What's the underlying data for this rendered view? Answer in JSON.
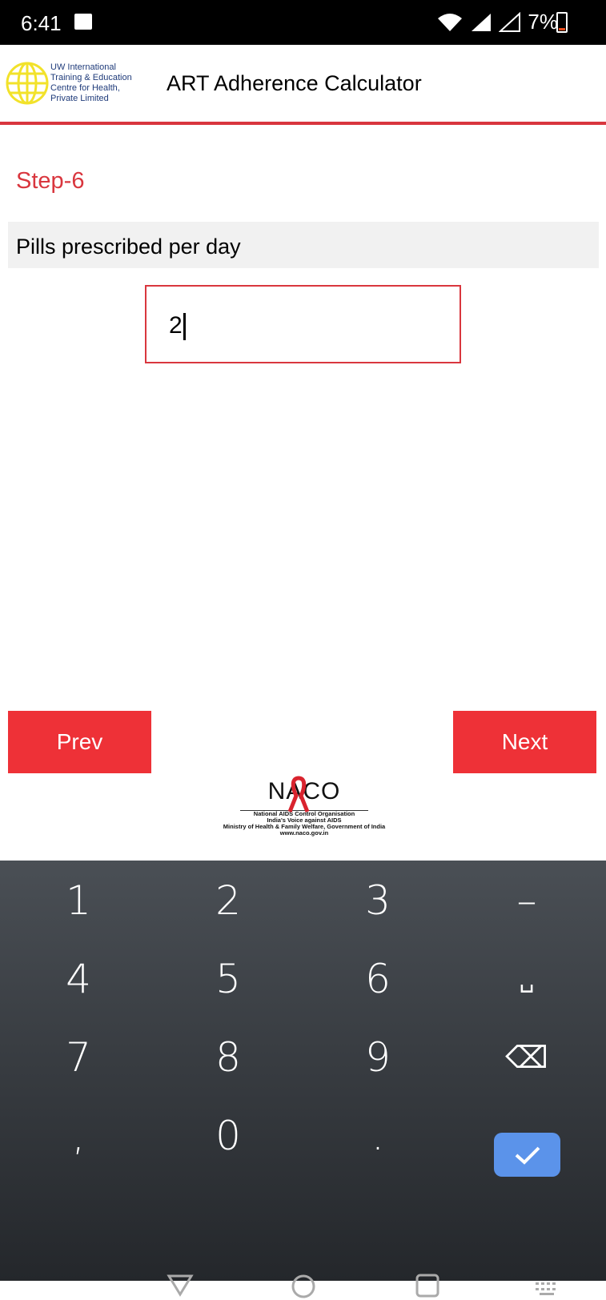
{
  "status_bar": {
    "time": "6:41",
    "battery": "7%"
  },
  "header": {
    "logo_text": [
      "UW International",
      "Training & Education",
      "Centre for Health,",
      "Private Limited"
    ],
    "title": "ART Adherence Calculator"
  },
  "main": {
    "step": "Step-6",
    "question": "Pills prescribed per day",
    "input_value": "2",
    "prev_label": "Prev",
    "next_label": "Next"
  },
  "footer": {
    "logo_name": "NACO",
    "lines": [
      "National AIDS Control Organisation",
      "India's Voice against AIDS",
      "Ministry of Health & Family Welfare, Government of India",
      "www.naco.gov.in"
    ]
  },
  "keyboard": {
    "keys": [
      "1",
      "2",
      "3",
      "–",
      "4",
      "5",
      "6",
      "␣",
      "7",
      "8",
      "9",
      "⌫",
      ",",
      "0",
      "."
    ]
  },
  "colors": {
    "accent": "#ee3137",
    "step": "#d9363e",
    "done": "#5b93ea"
  }
}
